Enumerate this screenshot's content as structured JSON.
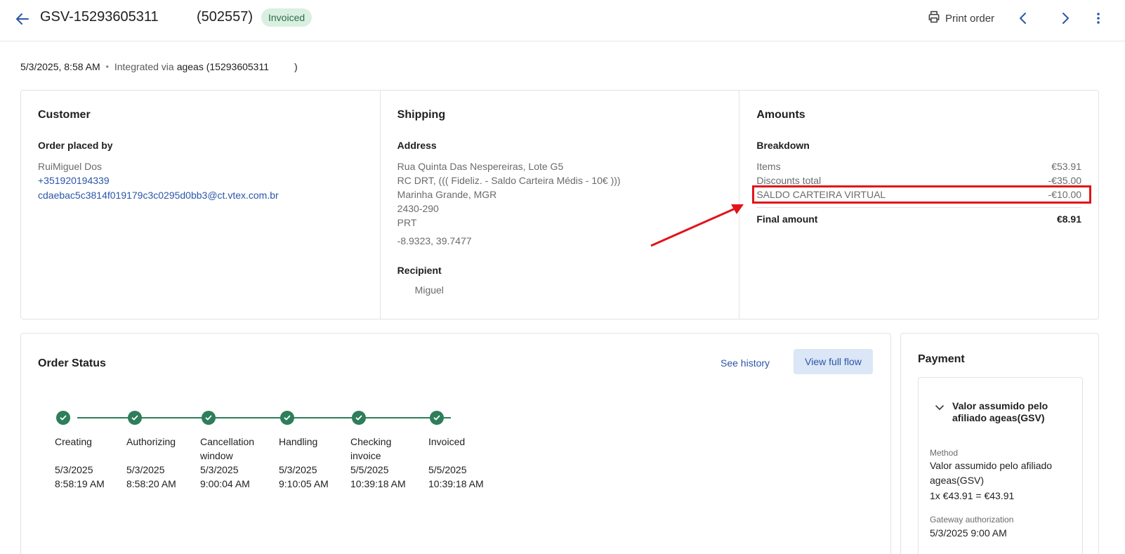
{
  "header": {
    "order_id": "GSV-15293605311",
    "sequence": "(502557)",
    "status_badge": "Invoiced",
    "print_label": "Print order"
  },
  "meta": {
    "datetime": "5/3/2025, 8:58 AM",
    "separator": "•",
    "integrated_label": "Integrated via",
    "integration": "ageas (15293605311",
    "integration_close": ")"
  },
  "customer": {
    "title": "Customer",
    "subtitle": "Order placed by",
    "name": "RuiMiguel Dos",
    "phone": "+351920194339",
    "email": "cdaebac5c3814f019179c3c0295d0bb3@ct.vtex.com.br"
  },
  "shipping": {
    "title": "Shipping",
    "address_label": "Address",
    "address_lines": [
      "Rua Quinta Das Nespereiras, Lote G5",
      "RC DRT, ((( Fideliz. - Saldo Carteira Médis - 10€ )))",
      "Marinha Grande, MGR",
      "2430-290",
      "PRT"
    ],
    "coordinates": "-8.9323, 39.7477",
    "recipient_label": "Recipient",
    "recipient": "Miguel"
  },
  "amounts": {
    "title": "Amounts",
    "breakdown_label": "Breakdown",
    "rows": [
      {
        "label": "Items",
        "value": "€53.91"
      },
      {
        "label": "Discounts total",
        "value": "-€35.00"
      },
      {
        "label": "SALDO CARTEIRA VIRTUAL",
        "value": "-€10.00"
      }
    ],
    "final_label": "Final amount",
    "final_value": "€8.91"
  },
  "order_status": {
    "title": "Order Status",
    "see_history": "See history",
    "view_full_flow": "View full flow",
    "steps": [
      {
        "label": "Creating",
        "date": "5/3/2025",
        "time": "8:58:19 AM"
      },
      {
        "label": "Authorizing",
        "date": "5/3/2025",
        "time": "8:58:20 AM"
      },
      {
        "label": "Cancellation window",
        "date": "5/3/2025",
        "time": "9:00:04 AM"
      },
      {
        "label": "Handling",
        "date": "5/3/2025",
        "time": "9:10:05 AM"
      },
      {
        "label": "Checking invoice",
        "date": "5/5/2025",
        "time": "10:39:18 AM"
      },
      {
        "label": "Invoiced",
        "date": "5/5/2025",
        "time": "10:39:18 AM"
      }
    ]
  },
  "payment": {
    "title": "Payment",
    "group_title": "Valor assumido pelo afiliado ageas(GSV)",
    "method_label": "Method",
    "method_value": "Valor assumido pelo afiliado ageas(GSV)",
    "installment": "1x €43.91 = €43.91",
    "gateway_label": "Gateway authorization",
    "gateway_value": "5/3/2025 9:00 AM"
  },
  "colors": {
    "accent": "#2b56a8",
    "success": "#2e7d5b",
    "highlight": "#e0141b"
  }
}
